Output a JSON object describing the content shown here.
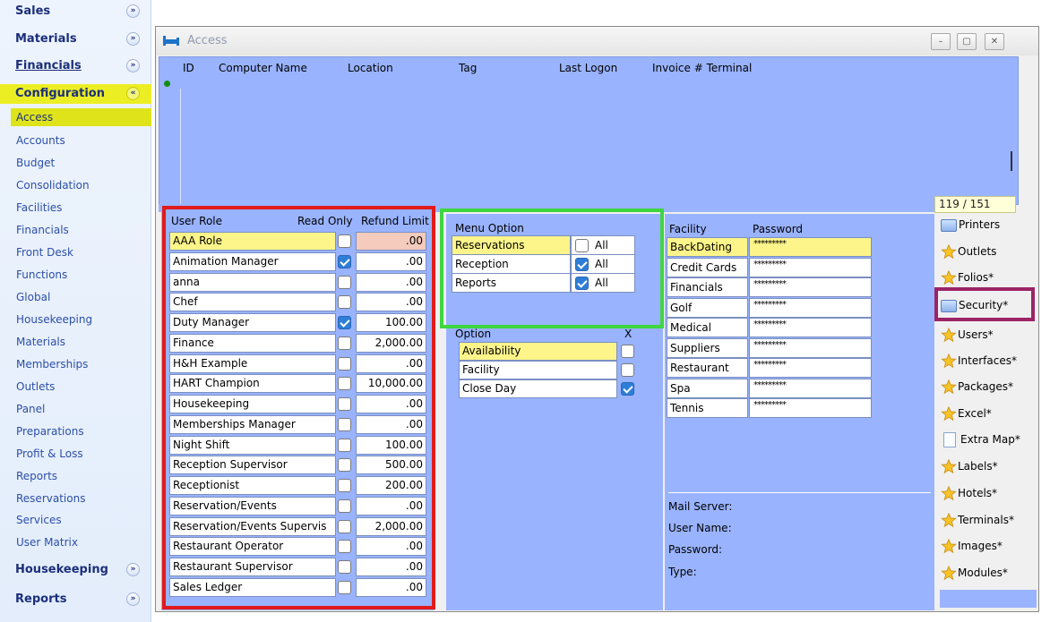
{
  "nav": {
    "groups": {
      "sales": "Sales",
      "materials": "Materials",
      "financials": "Financials",
      "configuration": "Configuration",
      "housekeeping": "Housekeeping",
      "reports": "Reports"
    },
    "expand_glyph": "»",
    "collapse_glyph": "«",
    "items": [
      "Access",
      "Accounts",
      "Budget",
      "Consolidation",
      "Facilities",
      "Financials",
      "Front Desk",
      "Functions",
      "Global",
      "Housekeeping",
      "Materials",
      "Memberships",
      "Outlets",
      "Panel",
      "Preparations",
      "Profit & Loss",
      "Reports",
      "Reservations",
      "Services",
      "User Matrix"
    ],
    "selected": "Access"
  },
  "window": {
    "title": "Access",
    "buttons": {
      "minimize": "–",
      "restore": "▢",
      "close": "✕"
    }
  },
  "access_grid": {
    "columns": [
      "ID",
      "Computer Name",
      "Location",
      "Tag",
      "Last Logon",
      "Invoice # Terminal"
    ],
    "counter": "119 / 151"
  },
  "roles": {
    "headers": {
      "role": "User Role",
      "read_only": "Read Only",
      "refund": "Refund Limit"
    },
    "rows": [
      {
        "name": "AAA Role",
        "read_only": false,
        "limit": ".00"
      },
      {
        "name": "Animation Manager",
        "read_only": true,
        "limit": ".00"
      },
      {
        "name": "anna",
        "read_only": false,
        "limit": ".00"
      },
      {
        "name": "Chef",
        "read_only": false,
        "limit": ".00"
      },
      {
        "name": "Duty Manager",
        "read_only": true,
        "limit": "100.00"
      },
      {
        "name": "Finance",
        "read_only": false,
        "limit": "2,000.00"
      },
      {
        "name": "H&H Example",
        "read_only": false,
        "limit": ".00"
      },
      {
        "name": "HART Champion",
        "read_only": false,
        "limit": "10,000.00"
      },
      {
        "name": "Housekeeping",
        "read_only": false,
        "limit": ".00"
      },
      {
        "name": "Memberships Manager",
        "read_only": false,
        "limit": ".00"
      },
      {
        "name": "Night Shift",
        "read_only": false,
        "limit": "100.00"
      },
      {
        "name": "Reception Supervisor",
        "read_only": false,
        "limit": "500.00"
      },
      {
        "name": "Receptionist",
        "read_only": false,
        "limit": "200.00"
      },
      {
        "name": "Reservation/Events",
        "read_only": false,
        "limit": ".00"
      },
      {
        "name": "Reservation/Events Supervis",
        "read_only": false,
        "limit": "2,000.00"
      },
      {
        "name": "Restaurant Operator",
        "read_only": false,
        "limit": ".00"
      },
      {
        "name": "Restaurant Supervisor",
        "read_only": false,
        "limit": ".00"
      },
      {
        "name": "Sales Ledger",
        "read_only": false,
        "limit": ".00"
      }
    ]
  },
  "menu_options": {
    "header": "Menu Option",
    "all_label": "All",
    "rows": [
      {
        "name": "Reservations",
        "checked": false
      },
      {
        "name": "Reception",
        "checked": true
      },
      {
        "name": "Reports",
        "checked": true
      }
    ]
  },
  "options": {
    "header": "Option",
    "x_header": "X",
    "rows": [
      {
        "name": "Availability",
        "checked": false
      },
      {
        "name": "Facility",
        "checked": false
      },
      {
        "name": "Close Day",
        "checked": true
      }
    ]
  },
  "facilities": {
    "headers": {
      "facility": "Facility",
      "password": "Password"
    },
    "rows": [
      {
        "name": "BackDating",
        "password": "*********"
      },
      {
        "name": "Credit Cards",
        "password": "*********"
      },
      {
        "name": "Financials",
        "password": "*********"
      },
      {
        "name": "Golf",
        "password": "*********"
      },
      {
        "name": "Medical",
        "password": "*********"
      },
      {
        "name": "Suppliers",
        "password": "*********"
      },
      {
        "name": "Restaurant",
        "password": "*********"
      },
      {
        "name": "Spa",
        "password": "*********"
      },
      {
        "name": "Tennis",
        "password": "*********"
      }
    ]
  },
  "mail": {
    "server": "Mail Server:",
    "user": "User Name:",
    "password": "Password:",
    "type": "Type:"
  },
  "toolbar": {
    "printers": "Printers",
    "outlets": "Outlets",
    "folios": "Folios*",
    "security": "Security*",
    "users": "Users*",
    "interfaces": "Interfaces*",
    "packages": "Packages*",
    "excel": "Excel*",
    "extra_map": "Extra Map*",
    "labels": "Labels*",
    "hotels": "Hotels*",
    "terminals": "Terminals*",
    "images": "Images*",
    "modules": "Modules*"
  },
  "colors": {
    "grid_blue": "#99b3ff",
    "highlight_yellow": "#fdf58a",
    "nav_selected": "#dfe41a",
    "annotation_red": "#e11b1b",
    "annotation_green": "#3fd63f",
    "annotation_purple": "#9b2466"
  }
}
